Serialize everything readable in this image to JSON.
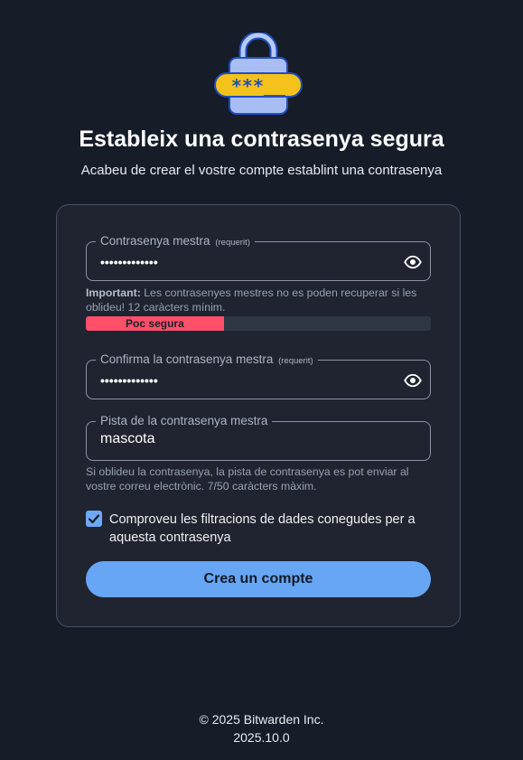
{
  "header": {
    "logo_icon": "lock-password-icon",
    "password_mask": "***__",
    "title": "Estableix una contrasenya segura",
    "subtitle": "Acabeu de crear el vostre compte establint una contrasenya"
  },
  "form": {
    "master_password": {
      "label": "Contrasenya mestra",
      "required_tag": "(requerit)",
      "masked_value": "•••••••••••••",
      "toggle_icon": "eye-icon"
    },
    "password_note": {
      "bold": "Important:",
      "text": " Les contrasenyes mestres no es poden recuperar si les oblideu! 12 caràcters mínim."
    },
    "strength": {
      "label": "Poc segura",
      "fill_fraction": 0.4,
      "color": "#ff4f69"
    },
    "confirm_password": {
      "label": "Confirma la contrasenya mestra",
      "required_tag": "(requerit)",
      "masked_value": "•••••••••••••",
      "toggle_icon": "eye-icon"
    },
    "hint": {
      "label": "Pista de la contrasenya mestra",
      "value": "mascota",
      "note": "Si oblideu la contrasenya, la pista de contrasenya es pot enviar al vostre correu electrònic. 7/50 caràcters màxim."
    },
    "breach_check": {
      "checked": true,
      "label": "Comproveu les filtracions de dades conegudes per a aquesta contrasenya"
    },
    "submit_label": "Crea un compte"
  },
  "footer": {
    "copyright": "© 2025 Bitwarden Inc.",
    "version": "2025.10.0"
  },
  "colors": {
    "background": "#161c28",
    "card": "#1f2430",
    "accent": "#66a6f5",
    "danger": "#ff4f69",
    "lock_body": "#a9bdf5",
    "lock_band": "#f5c21b"
  }
}
